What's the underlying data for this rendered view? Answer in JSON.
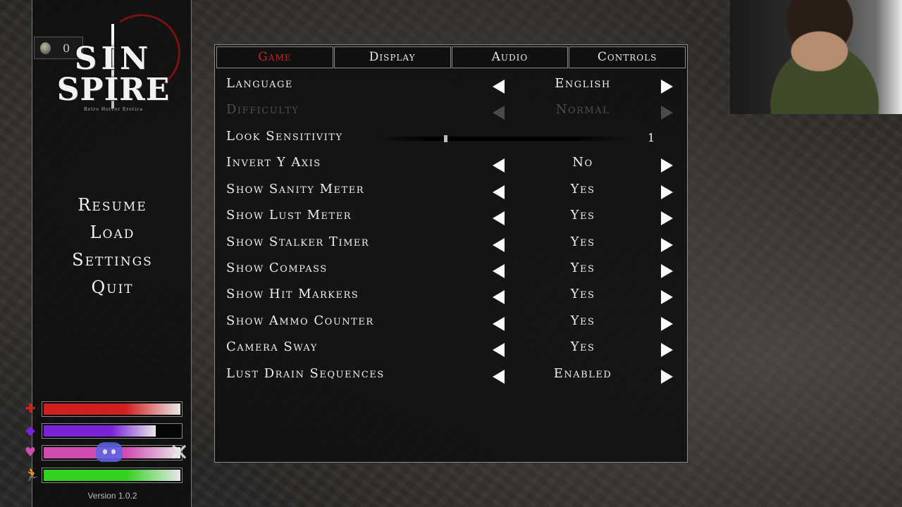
{
  "game": {
    "logo_line1": "SIN",
    "logo_line2": "SPIRE",
    "logo_tagline": "Retro Horror Erotica",
    "coin_count": "0"
  },
  "menu": {
    "resume": "Resume",
    "load": "Load",
    "settings": "Settings",
    "quit": "Quit"
  },
  "status_bars": [
    {
      "icon": "health-cross-icon",
      "color": "#d01f1f",
      "fill_fraction": 1.0
    },
    {
      "icon": "sanity-gem-icon",
      "color": "#7a22d6",
      "fill_fraction": 0.82
    },
    {
      "icon": "lust-heart-icon",
      "color": "#d04cb0",
      "fill_fraction": 1.0
    },
    {
      "icon": "stamina-runner-icon",
      "color": "#34d022",
      "fill_fraction": 1.0
    }
  ],
  "version": "Version 1.0.2",
  "tabs": [
    {
      "label": "Game",
      "active": true
    },
    {
      "label": "Display",
      "active": false
    },
    {
      "label": "Audio",
      "active": false
    },
    {
      "label": "Controls",
      "active": false
    }
  ],
  "settings": {
    "language": {
      "label": "Language",
      "value": "English"
    },
    "difficulty": {
      "label": "Difficulty",
      "value": "Normal",
      "disabled": true
    },
    "look_sensitivity": {
      "label": "Look Sensitivity",
      "value": "1",
      "slider_fraction": 0.27
    },
    "invert_y": {
      "label": "Invert Y Axis",
      "value": "No"
    },
    "sanity_meter": {
      "label": "Show Sanity Meter",
      "value": "Yes"
    },
    "lust_meter": {
      "label": "Show Lust Meter",
      "value": "Yes"
    },
    "stalker_timer": {
      "label": "Show Stalker Timer",
      "value": "Yes"
    },
    "compass": {
      "label": "Show Compass",
      "value": "Yes"
    },
    "hit_markers": {
      "label": "Show Hit Markers",
      "value": "Yes"
    },
    "ammo_counter": {
      "label": "Show Ammo Counter",
      "value": "Yes"
    },
    "camera_sway": {
      "label": "Camera Sway",
      "value": "Yes"
    },
    "lust_drain": {
      "label": "Lust Drain Sequences",
      "value": "Enabled"
    }
  },
  "colors": {
    "active_tab": "#c2262b",
    "panel_border": "#8a8a8a"
  }
}
